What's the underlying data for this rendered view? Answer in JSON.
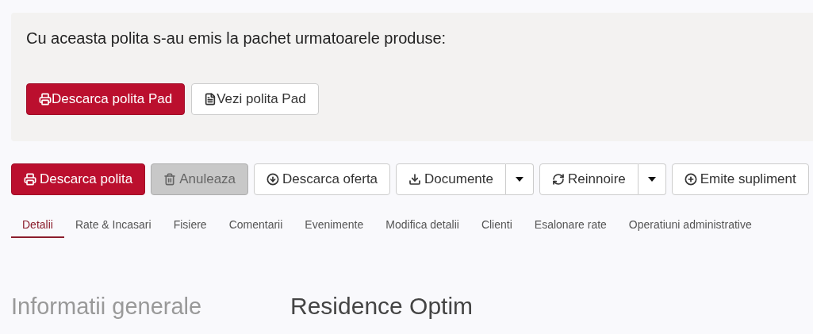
{
  "notice": {
    "text": "Cu aceasta polita s-au emis la pachet urmatoarele produse:",
    "buttons": [
      {
        "label": "Descarca polita Pad",
        "kind": "primary"
      },
      {
        "label": "Vezi polita Pad",
        "kind": "default"
      }
    ]
  },
  "toolbar": [
    {
      "label": "Descarca polita",
      "kind": "primary",
      "disabled": false,
      "split": false
    },
    {
      "label": "Anuleaza",
      "kind": "default",
      "disabled": true,
      "split": false
    },
    {
      "label": "Descarca oferta",
      "kind": "default",
      "disabled": false,
      "split": false
    },
    {
      "label": "Documente",
      "kind": "default",
      "disabled": false,
      "split": true
    },
    {
      "label": "Reinnoire",
      "kind": "default",
      "disabled": false,
      "split": true
    },
    {
      "label": "Emite supliment",
      "kind": "default",
      "disabled": false,
      "split": false
    }
  ],
  "tabs": [
    {
      "label": "Detalii",
      "selected": true
    },
    {
      "label": "Rate & Incasari",
      "selected": false
    },
    {
      "label": "Fisiere",
      "selected": false
    },
    {
      "label": "Comentarii",
      "selected": false
    },
    {
      "label": "Evenimente",
      "selected": false
    },
    {
      "label": "Modifica detalii",
      "selected": false
    },
    {
      "label": "Clienti",
      "selected": false
    },
    {
      "label": "Esalonare rate",
      "selected": false
    },
    {
      "label": "Operatiuni administrative",
      "selected": false
    }
  ],
  "section_title": "Informatii generale",
  "product_title": "Residence Optim"
}
